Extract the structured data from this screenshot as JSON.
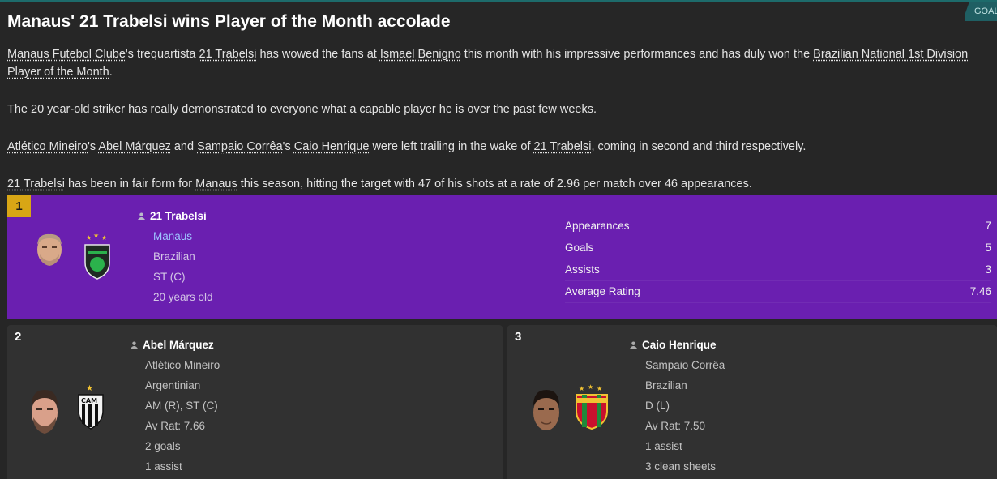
{
  "header": {
    "goal_tag": "GOAL",
    "title": "Manaus' 21 Trabelsi wins Player of the Month accolade"
  },
  "article": {
    "p1": {
      "club": "Manaus Futebol Clube",
      "t1": "'s trequartista ",
      "player": "21 Trabelsi",
      "t2": " has wowed the fans at ",
      "stadium": "Ismael Benigno",
      "t3": " this month with his impressive performances and has duly won the ",
      "award": "Brazilian National 1st Division Player of the Month",
      "t4": "."
    },
    "p2": "The 20 year-old striker has really demonstrated to everyone what a capable player he is over the past few weeks.",
    "p3": {
      "club_a": "Atlético Mineiro",
      "t1": "'s ",
      "player_a": "Abel Márquez",
      "t2": " and ",
      "club_b": "Sampaio Corrêa",
      "t3": "'s ",
      "player_b": "Caio Henrique",
      "t4": " were left trailing in the wake of ",
      "player_c": "21 Trabelsi",
      "t5": ", coming in second and third respectively."
    },
    "p4": {
      "player": "21 Trabelsi",
      "t1": " has been in fair form for ",
      "club": "Manaus",
      "t2": " this season, hitting the target with 47 of his shots at a rate of 2.96 per match over 46 appearances."
    }
  },
  "winner": {
    "rank": "1",
    "name": "21 Trabelsi",
    "club": "Manaus",
    "nationality": "Brazilian",
    "position": "ST (C)",
    "age": "20 years old",
    "stats": [
      {
        "label": "Appearances",
        "value": "7"
      },
      {
        "label": "Goals",
        "value": "5"
      },
      {
        "label": "Assists",
        "value": "3"
      },
      {
        "label": "Average Rating",
        "value": "7.46"
      }
    ],
    "colors": {
      "panel": "#6a1fb0",
      "rank_badge": "#d8a615"
    }
  },
  "runners_up": [
    {
      "rank": "2",
      "name": "Abel Márquez",
      "lines": [
        "Atlético Mineiro",
        "Argentinian",
        "AM (R), ST (C)",
        "Av Rat: 7.66",
        "2 goals",
        "1 assist"
      ]
    },
    {
      "rank": "3",
      "name": "Caio Henrique",
      "lines": [
        "Sampaio Corrêa",
        "Brazilian",
        "D (L)",
        "Av Rat: 7.50",
        "1 assist",
        "3 clean sheets"
      ]
    }
  ]
}
